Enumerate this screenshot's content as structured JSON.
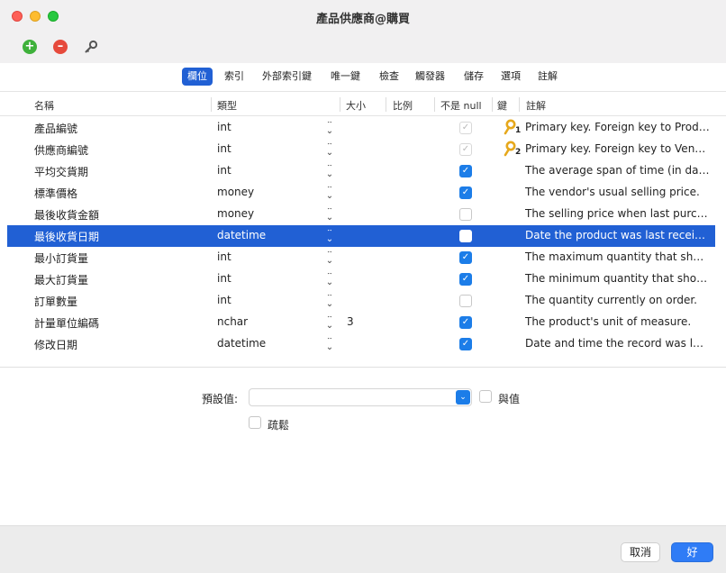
{
  "window": {
    "title": "產品供應商@購買"
  },
  "toolbar": {
    "add": "+",
    "remove": "–"
  },
  "tabs": [
    {
      "label": "欄位",
      "active": true
    },
    {
      "label": "索引",
      "active": false
    },
    {
      "label": "外部索引鍵",
      "active": false
    },
    {
      "label": "唯一鍵",
      "active": false
    },
    {
      "label": "檢查",
      "active": false
    },
    {
      "label": "觸發器",
      "active": false
    },
    {
      "label": "儲存",
      "active": false
    },
    {
      "label": "選項",
      "active": false
    },
    {
      "label": "註解",
      "active": false
    }
  ],
  "columns": {
    "name": "名稱",
    "type": "類型",
    "size": "大小",
    "scale": "比例",
    "not_null": "不是 null",
    "key": "鍵",
    "comment": "註解"
  },
  "rows": [
    {
      "name": "產品編號",
      "type": "int",
      "size": "",
      "not_null": "dim",
      "key": "1",
      "comment": "Primary key. Foreign key to Produ..."
    },
    {
      "name": "供應商編號",
      "type": "int",
      "size": "",
      "not_null": "dim",
      "key": "2",
      "comment": "Primary key. Foreign key to Vend..."
    },
    {
      "name": "平均交貨期",
      "type": "int",
      "size": "",
      "not_null": "on",
      "key": "",
      "comment": "The average span of time (in day..."
    },
    {
      "name": "標準價格",
      "type": "money",
      "size": "",
      "not_null": "on",
      "key": "",
      "comment": "The vendor's usual selling price."
    },
    {
      "name": "最後收貨金額",
      "type": "money",
      "size": "",
      "not_null": "off",
      "key": "",
      "comment": "The selling price when last purch..."
    },
    {
      "name": "最後收貨日期",
      "type": "datetime",
      "size": "",
      "not_null": "off",
      "key": "",
      "comment": "Date the product was last receive...",
      "selected": true
    },
    {
      "name": "最小訂貨量",
      "type": "int",
      "size": "",
      "not_null": "on",
      "key": "",
      "comment": "The maximum quantity that shoul..."
    },
    {
      "name": "最大訂貨量",
      "type": "int",
      "size": "",
      "not_null": "on",
      "key": "",
      "comment": "The minimum quantity that shoul..."
    },
    {
      "name": "訂單數量",
      "type": "int",
      "size": "",
      "not_null": "off",
      "key": "",
      "comment": "The quantity currently on order."
    },
    {
      "name": "計量單位編碼",
      "type": "nchar",
      "size": "3",
      "not_null": "on",
      "key": "",
      "comment": "The product's unit of measure."
    },
    {
      "name": "修改日期",
      "type": "datetime",
      "size": "",
      "not_null": "on",
      "key": "",
      "comment": "Date and time the record was last..."
    }
  ],
  "form": {
    "default_label": "預設值:",
    "default_value": "",
    "with_values_label": "與值",
    "sparse_label": "疏鬆"
  },
  "footer": {
    "cancel": "取消",
    "ok": "好"
  },
  "colors": {
    "accent": "#2160d4",
    "checkbox": "#1c7de8",
    "key_icon": "#e6a81c"
  }
}
